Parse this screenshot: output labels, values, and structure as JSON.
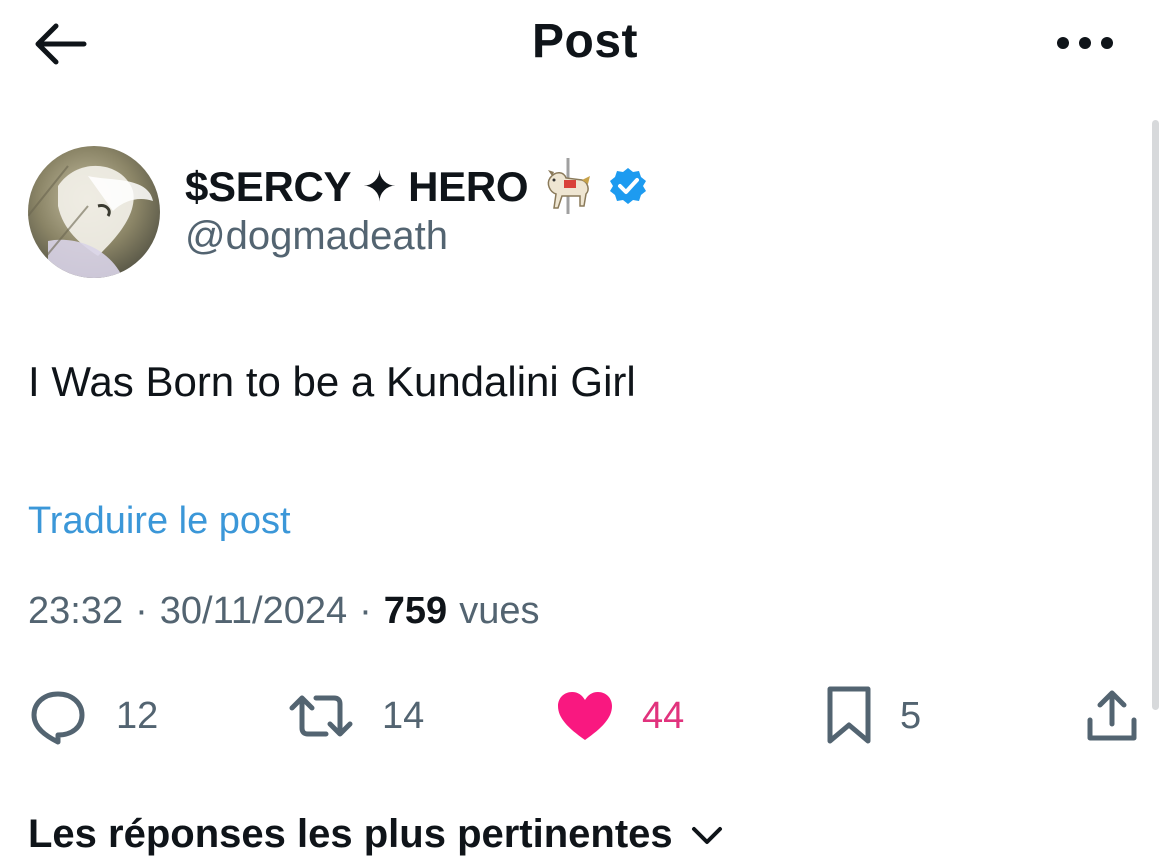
{
  "header": {
    "title": "Post",
    "back_icon": "arrow-left-icon",
    "more_icon": "more-horizontal-icon"
  },
  "author": {
    "display_name": "$SERCY ✦ HERO",
    "emoji": "🎠",
    "handle": "@dogmadeath",
    "verified": true,
    "verified_color": "#1d9bf0"
  },
  "post": {
    "text": "I Was Born to be a Kundalini Girl",
    "translate_label": "Traduire le post",
    "time": "23:32",
    "date": "30/11/2024",
    "views_count": "759",
    "views_label": "vues"
  },
  "actions": {
    "replies": "12",
    "reposts": "14",
    "likes": "44",
    "bookmarks": "5",
    "liked": true,
    "like_color": "#f91880"
  },
  "replies_sort": {
    "label": "Les réponses les plus pertinentes"
  },
  "colors": {
    "link": "#3b97d8",
    "secondary_text": "#536471",
    "primary_text": "#0f1419"
  }
}
